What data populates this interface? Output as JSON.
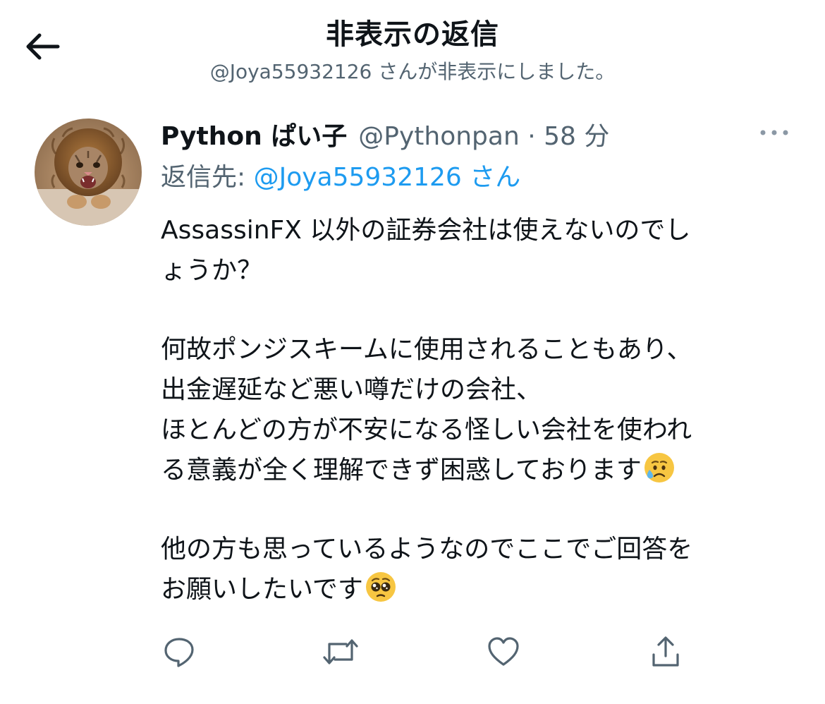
{
  "header": {
    "back_icon": "arrow-left-icon",
    "title": "非表示の返信",
    "subtitle": "@Joya55932126 さんが非表示にしました。"
  },
  "tweet": {
    "avatar_icon": "cat-lion-avatar",
    "display_name": "Python ぱい子",
    "handle_time": "@Pythonpan · 58 分",
    "more_icon": "more-dots-icon",
    "reply_label": "返信先: ",
    "reply_handle": "@Joya55932126 さん",
    "text_lines": [
      "AssassinFX 以外の証券会社は使えないのでし",
      "ょうか？",
      "",
      "何故ポンジスキームに使用されることもあり、",
      "出金遅延など悪い噂だけの会社、",
      "ほとんどの方が不安になる怪しい会社を使われ",
      "る意義が全く理解できず困惑しております",
      "",
      "他の方も思っているようなのでここでご回答を",
      "お願いしたいです"
    ],
    "emojis": {
      "line7": "sad-sweat-emoji",
      "line10": "pleading-face-emoji"
    }
  },
  "actions": {
    "reply_icon": "reply-icon",
    "retweet_icon": "retweet-icon",
    "like_icon": "heart-icon",
    "share_icon": "share-icon"
  },
  "colors": {
    "text": "#0f1419",
    "secondary": "#536471",
    "link": "#1d9bf0"
  }
}
